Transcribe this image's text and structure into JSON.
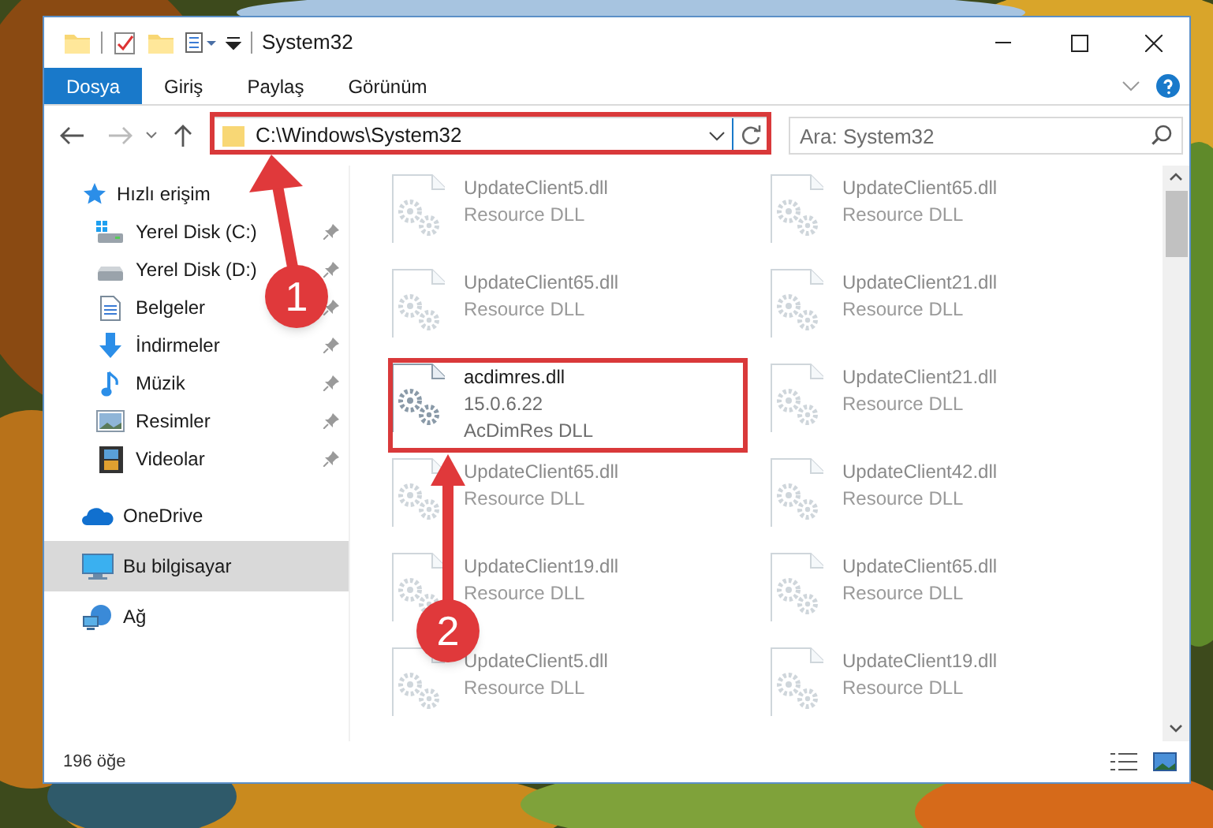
{
  "window": {
    "title": "System32"
  },
  "ribbon_tabs": [
    {
      "label": "Dosya",
      "kind": "file",
      "selected": false
    },
    {
      "label": "Giriş",
      "kind": "tab",
      "selected": false
    },
    {
      "label": "Paylaş",
      "kind": "tab",
      "selected": false
    },
    {
      "label": "Görünüm",
      "kind": "tab",
      "selected": false
    }
  ],
  "address_bar": {
    "path": "C:\\Windows\\System32"
  },
  "search": {
    "placeholder": "Ara: System32"
  },
  "sidebar": {
    "items": [
      {
        "label": "Hızlı erişim",
        "kind": "quick",
        "selected": false,
        "children": [
          {
            "label": "Yerel Disk (C:)",
            "kind": "system-drive",
            "pinned": true
          },
          {
            "label": "Yerel Disk (D:)",
            "kind": "drive",
            "pinned": true
          },
          {
            "label": "Belgeler",
            "kind": "documents",
            "pinned": true
          },
          {
            "label": "İndirmeler",
            "kind": "downloads",
            "pinned": true
          },
          {
            "label": "Müzik",
            "kind": "music",
            "pinned": true
          },
          {
            "label": "Resimler",
            "kind": "pictures",
            "pinned": true
          },
          {
            "label": "Videolar",
            "kind": "videos",
            "pinned": true
          }
        ]
      },
      {
        "label": "OneDrive",
        "kind": "cloud",
        "selected": false
      },
      {
        "label": "Bu bilgisayar",
        "kind": "computer",
        "selected": true
      },
      {
        "label": "Ağ",
        "kind": "network",
        "selected": false
      }
    ]
  },
  "files": [
    {
      "name": "UpdateClient5.dll",
      "description": "Resource DLL",
      "dimmed": true
    },
    {
      "name": "UpdateClient65.dll",
      "description": "Resource DLL",
      "dimmed": true
    },
    {
      "name": "UpdateClient65.dll",
      "description": "Resource DLL",
      "dimmed": true
    },
    {
      "name": "UpdateClient21.dll",
      "description": "Resource DLL",
      "dimmed": true
    },
    {
      "name": "acdimres.dll",
      "version": "15.0.6.22",
      "description": "AcDimRes DLL",
      "dimmed": false
    },
    {
      "name": "UpdateClient21.dll",
      "description": "Resource DLL",
      "dimmed": true
    },
    {
      "name": "UpdateClient65.dll",
      "description": "Resource DLL",
      "dimmed": true
    },
    {
      "name": "UpdateClient42.dll",
      "description": "Resource DLL",
      "dimmed": true
    },
    {
      "name": "UpdateClient19.dll",
      "description": "Resource DLL",
      "dimmed": true
    },
    {
      "name": "UpdateClient65.dll",
      "description": "Resource DLL",
      "dimmed": true
    },
    {
      "name": "UpdateClient5.dll",
      "description": "Resource DLL",
      "dimmed": true
    },
    {
      "name": "UpdateClient19.dll",
      "description": "Resource DLL",
      "dimmed": true
    }
  ],
  "status_bar": {
    "count": "196 öğe"
  },
  "callouts": [
    {
      "number": "1"
    },
    {
      "number": "2"
    }
  ]
}
